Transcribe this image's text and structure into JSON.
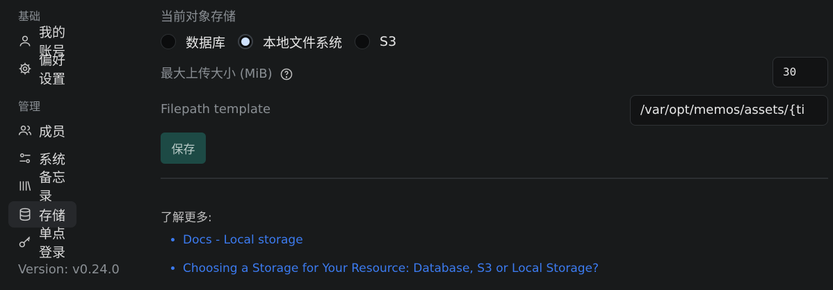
{
  "sidebar": {
    "section_basic": "基础",
    "section_manage": "管理",
    "items": [
      {
        "label": "我的账号",
        "icon": "user-icon"
      },
      {
        "label": "偏好设置",
        "icon": "gear-icon"
      },
      {
        "label": "成员",
        "icon": "users-icon"
      },
      {
        "label": "系统",
        "icon": "sliders-icon"
      },
      {
        "label": "备忘录",
        "icon": "library-icon"
      },
      {
        "label": "存储",
        "icon": "database-icon",
        "active": true
      },
      {
        "label": "单点登录",
        "icon": "key-icon"
      }
    ],
    "version": "Version: v0.24.0"
  },
  "storage": {
    "title": "当前对象存储",
    "options": [
      {
        "label": "数据库",
        "checked": false
      },
      {
        "label": "本地文件系统",
        "checked": true
      },
      {
        "label": "S3",
        "checked": false
      }
    ],
    "max_upload_label": "最大上传大小 (MiB)",
    "max_upload_value": "30",
    "filepath_label": "Filepath template",
    "filepath_value": "/var/opt/memos/assets/{ti",
    "save_label": "保存",
    "learn_more": "了解更多:",
    "links": [
      "Docs - Local storage",
      "Choosing a Storage for Your Resource: Database, S3 or Local Storage?"
    ]
  },
  "colors": {
    "background": "#181a1b",
    "link": "#3c7bf0",
    "save_button": "#1d4a45",
    "radio_checked": "#cfe2ff"
  }
}
